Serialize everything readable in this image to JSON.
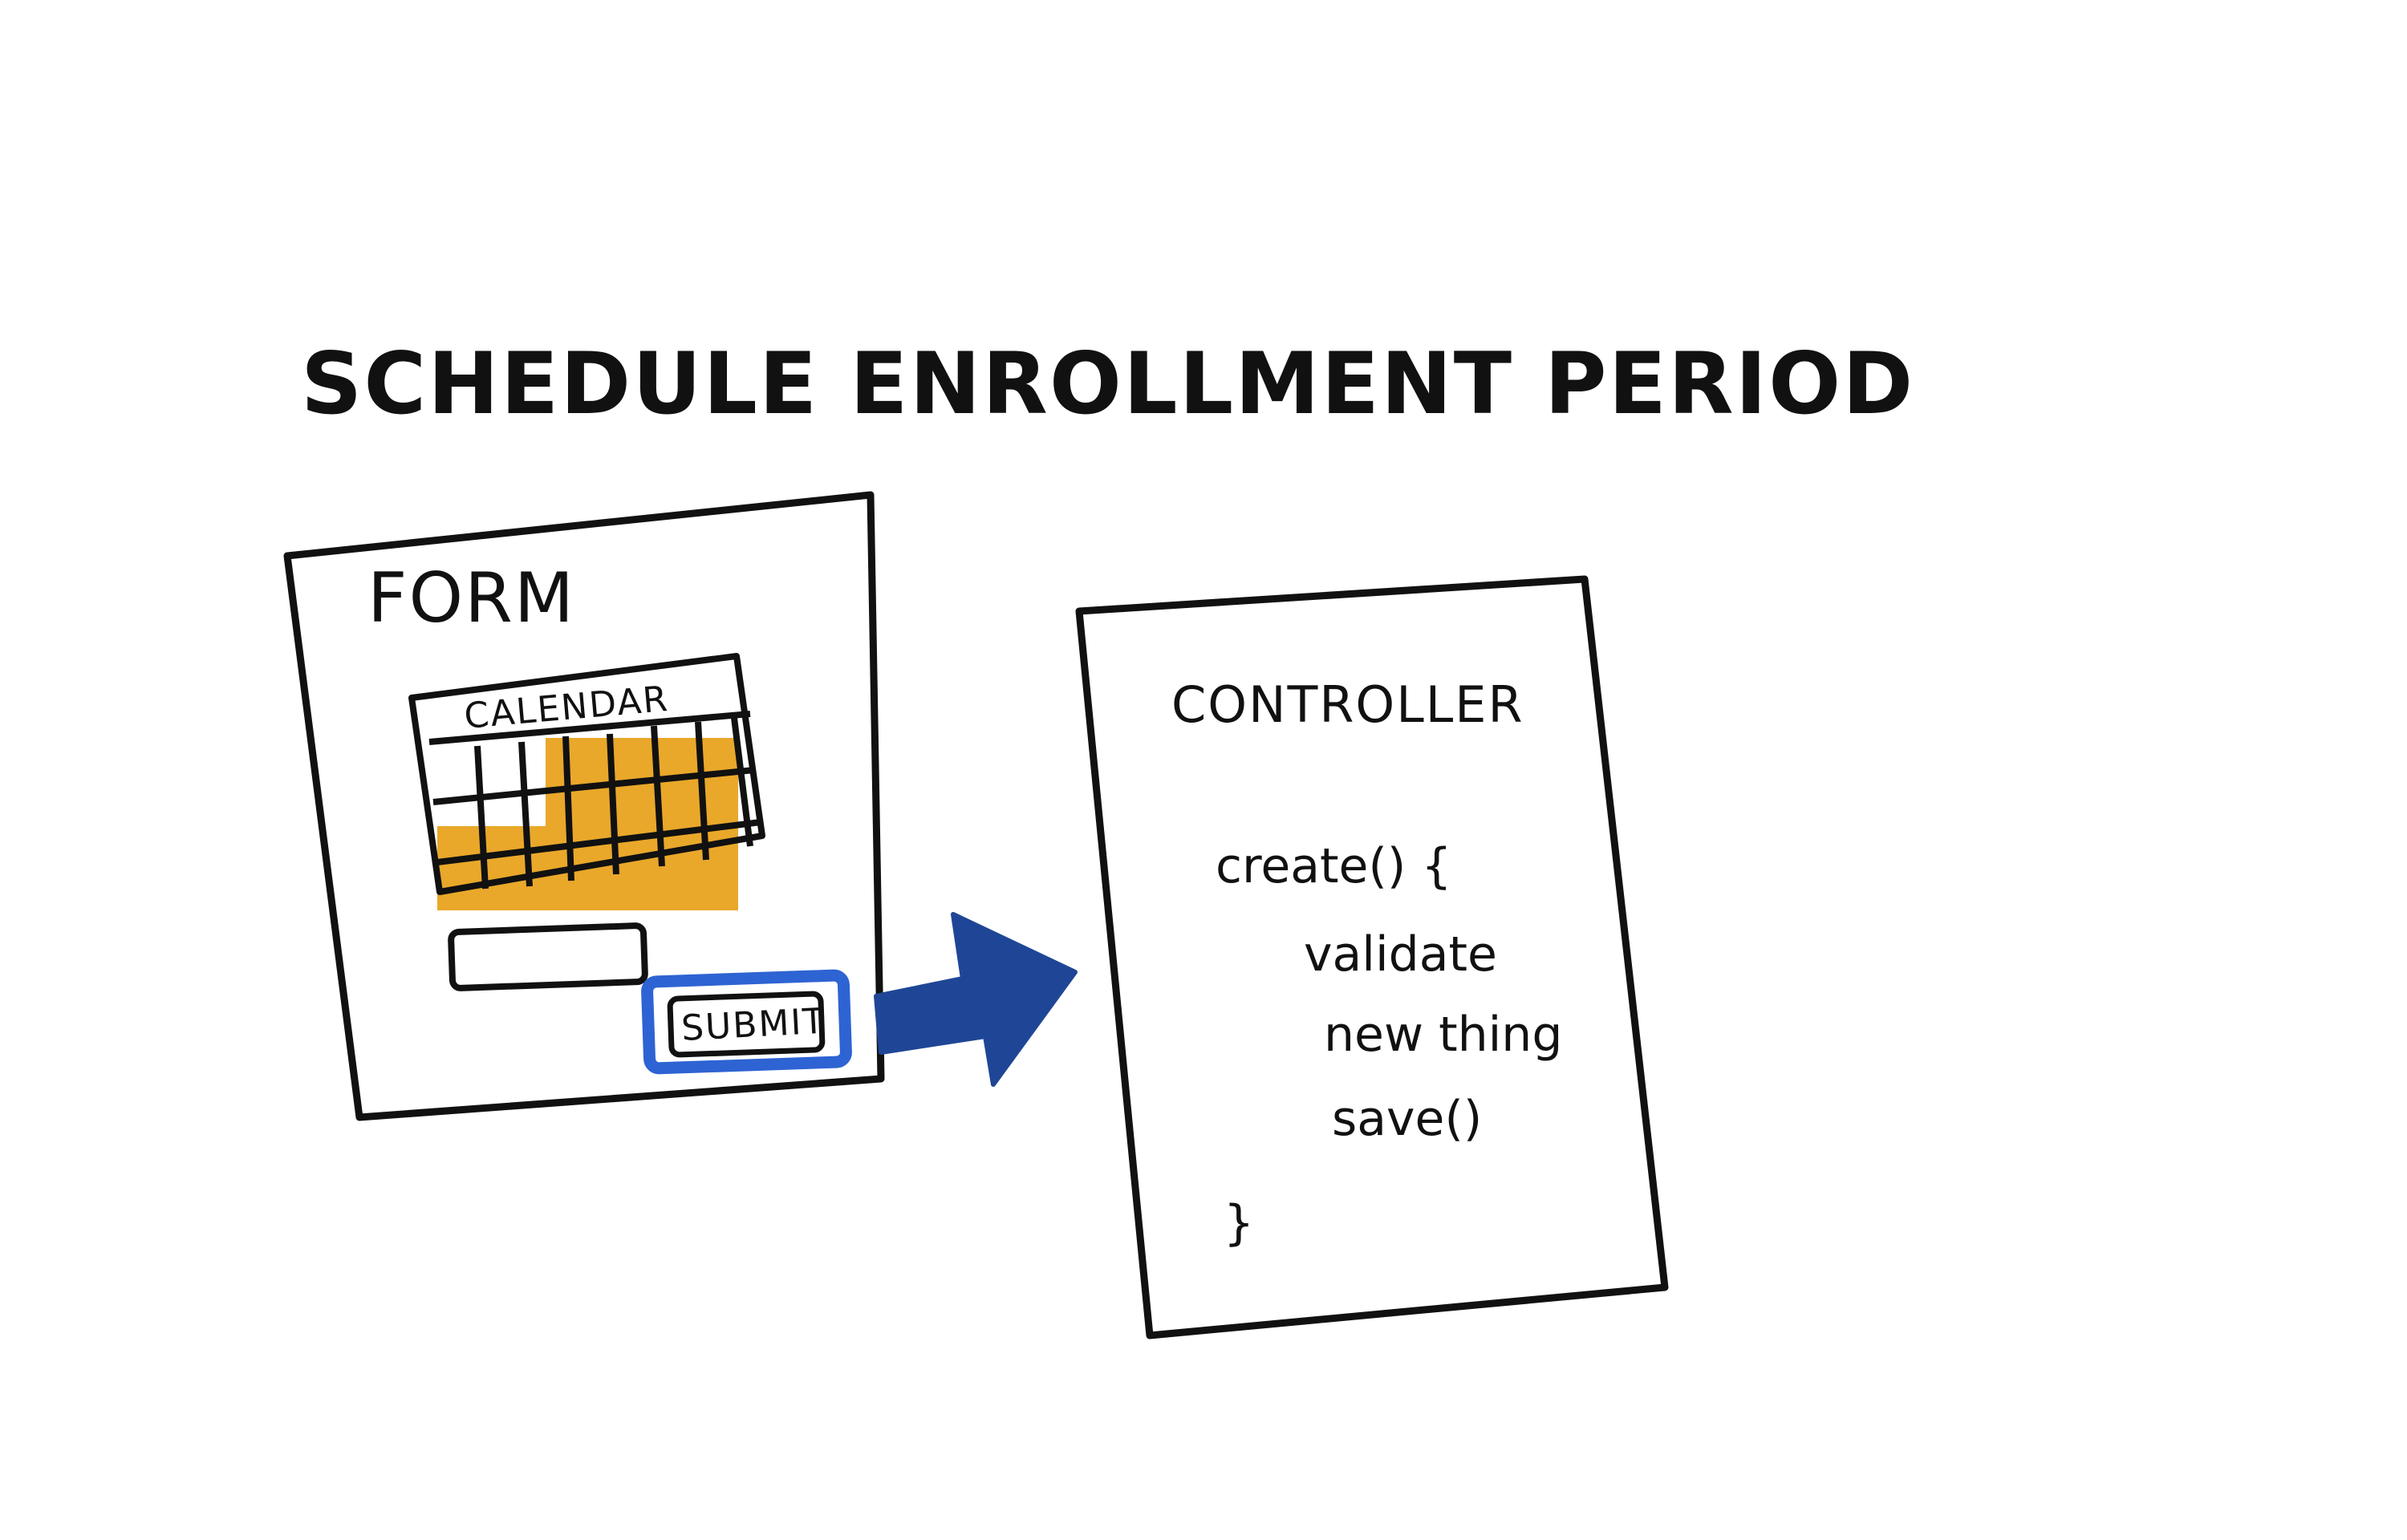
{
  "diagram": {
    "title": "SCHEDULE ENROLLMENT PERIOD",
    "form": {
      "label": "FORM",
      "calendar_label": "CALENDAR",
      "submit_label": "SUBMIT"
    },
    "controller": {
      "label": "CONTROLLER",
      "code_lines": [
        "create() {",
        "validate",
        "new thing",
        "save()",
        "}"
      ]
    }
  },
  "colors": {
    "ink": "#111111",
    "highlight": "#E9A82A",
    "submit_border": "#2E63D3",
    "arrow": "#1F4696"
  }
}
